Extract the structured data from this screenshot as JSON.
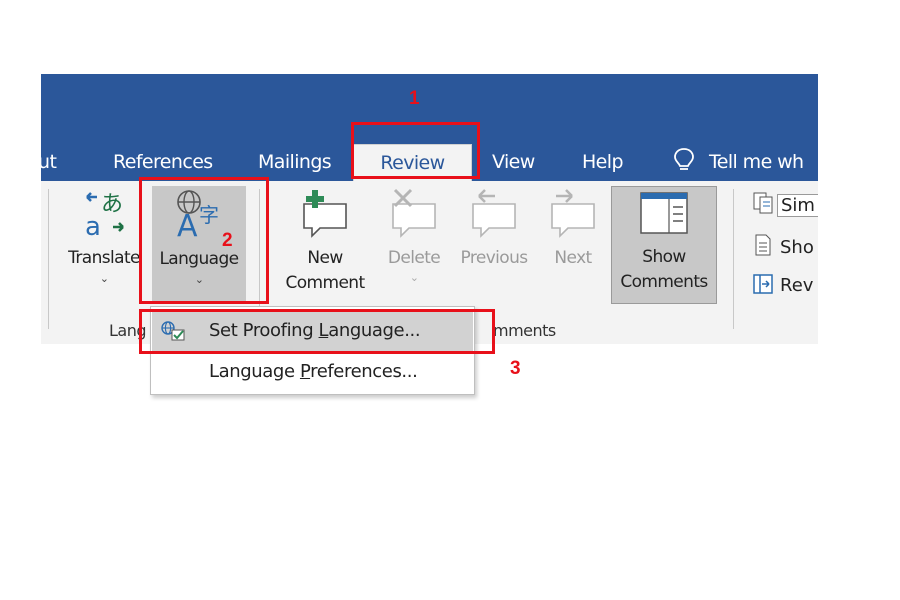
{
  "tabs": [
    {
      "label": "ut",
      "active": false
    },
    {
      "label": "References",
      "active": false
    },
    {
      "label": "Mailings",
      "active": false
    },
    {
      "label": "Review",
      "active": true
    },
    {
      "label": "View",
      "active": false
    },
    {
      "label": "Help",
      "active": false
    }
  ],
  "tell_me": {
    "icon": "lightbulb-icon",
    "text": "Tell me wh"
  },
  "ribbon": {
    "translate": {
      "label": "Translate",
      "chevron": "⌄"
    },
    "language": {
      "label": "Language",
      "chevron": "⌄"
    },
    "language_group_label": "Lang",
    "new_comment": {
      "line1": "New",
      "line2": "Comment"
    },
    "delete": {
      "line1": "Delete",
      "chevron": "⌄"
    },
    "previous": {
      "label": "Previous"
    },
    "next": {
      "label": "Next"
    },
    "show_comments": {
      "line1": "Show",
      "line2": "Comments"
    },
    "comments_group_label": "mments",
    "tracking": {
      "simple_markup": "Sim",
      "show_markup": "Sho",
      "reviewing_pane": "Rev"
    }
  },
  "language_menu": [
    {
      "label": "Set Proofing Language...",
      "underline": "L",
      "highlighted": true,
      "icon": "proofing-language-icon"
    },
    {
      "label": "Language Preferences...",
      "underline": "P",
      "highlighted": false
    }
  ],
  "annotations": {
    "step1": "1",
    "step2": "2",
    "step3": "3",
    "color": "#e8101a"
  },
  "colors": {
    "ribbon_blue": "#2b579a",
    "ribbon_bg": "#f3f3f3",
    "menu_highlight": "#d2d2d2"
  }
}
